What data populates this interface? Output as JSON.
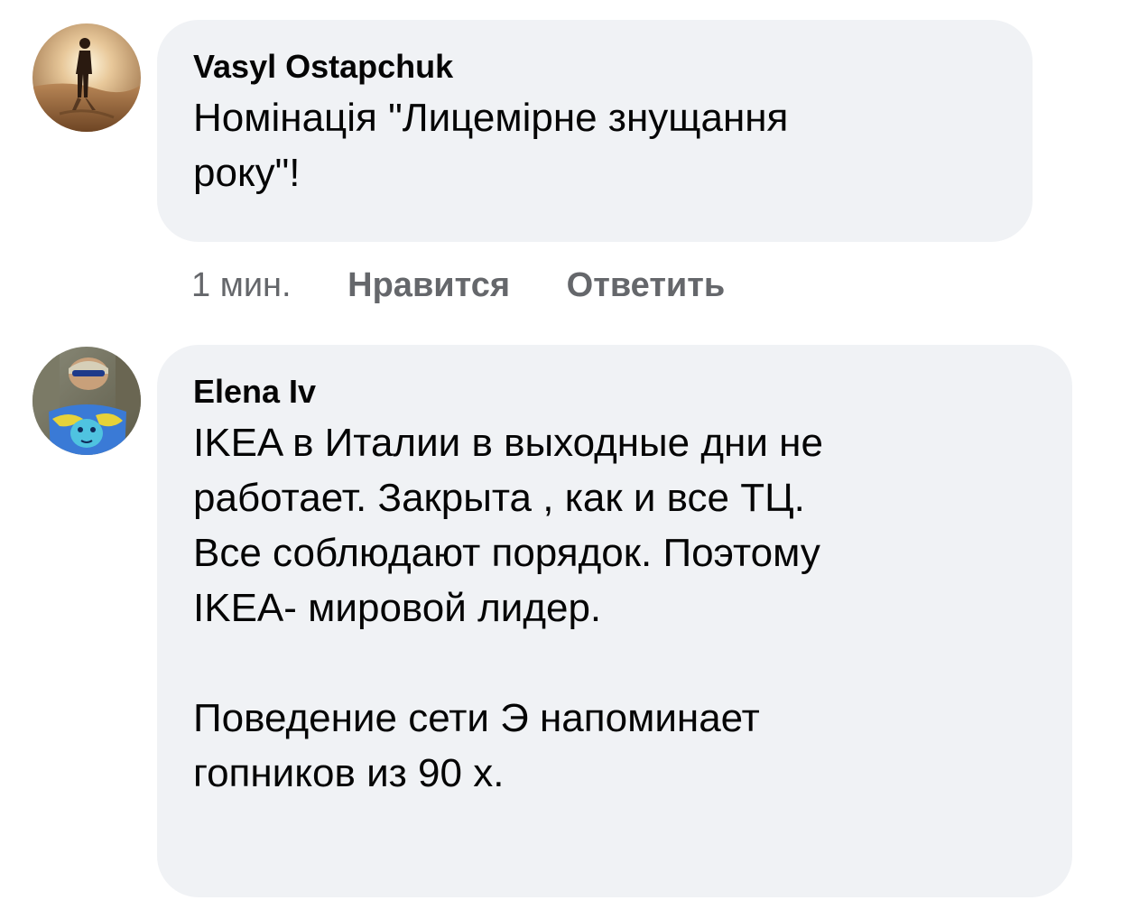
{
  "comments": [
    {
      "author": "Vasyl Ostapchuk",
      "avatar_icon": "desert-silhouette-avatar",
      "text": "Номінація \"Лицемірне знущання\nроку\"!",
      "time": "1 мин.",
      "like_label": "Нравится",
      "reply_label": "Ответить"
    },
    {
      "author": "Elena Iv",
      "avatar_icon": "blue-yellow-portrait-avatar",
      "text": "IKEA в Италии в выходные дни не\nработает. Закрыта , как и все ТЦ.\nВсе соблюдают порядок. Поэтому\nIKEA- мировой лидер.\n\nПоведение сети  Э напоминает\nгопников из 90 х."
    }
  ],
  "colors": {
    "bubble": "#f0f2f5",
    "text": "#050505",
    "secondary": "#65676b"
  }
}
